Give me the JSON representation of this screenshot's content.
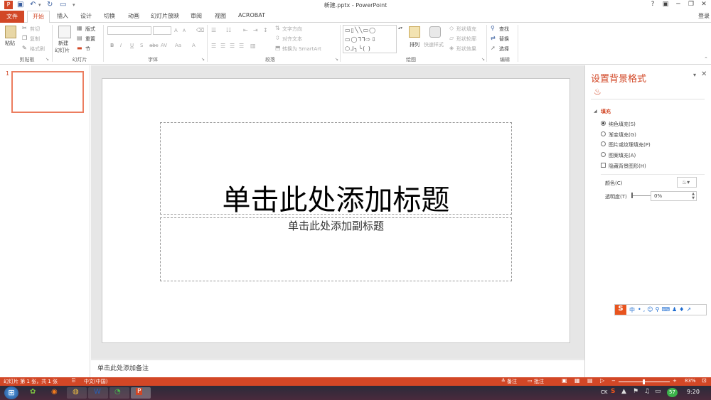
{
  "window": {
    "title": "新建.pptx - PowerPoint",
    "controls": {
      "help": "?",
      "minimize": "─",
      "restore": "❐",
      "close": "✕",
      "ribbon_options": "▣"
    },
    "login": "登录"
  },
  "tabs": [
    "文件",
    "开始",
    "插入",
    "设计",
    "切换",
    "动画",
    "幻灯片放映",
    "审阅",
    "视图",
    "ACROBAT"
  ],
  "ribbon": {
    "clipboard": {
      "paste": "粘贴",
      "cut": "剪切",
      "copy": "复制",
      "format_painter": "格式刷",
      "label": "剪贴板"
    },
    "slides": {
      "new_slide_line1": "新建",
      "new_slide_line2": "幻灯片",
      "layout": "版式",
      "reset": "重置",
      "section": "节",
      "label": "幻灯片"
    },
    "font": {
      "label": "字体",
      "bold": "B",
      "italic": "I",
      "underline": "U",
      "strike": "S",
      "shadow": "abc",
      "spacing": "AV",
      "case": "Aa",
      "grow": "A",
      "shrink": "A",
      "color": "A"
    },
    "paragraph": {
      "text_direction": "文字方向",
      "align_text": "对齐文本",
      "smartart": "转换为 SmartArt",
      "label": "段落"
    },
    "drawing": {
      "arrange": "排列",
      "quick_styles": "快速样式",
      "shape_fill": "形状填充",
      "shape_outline": "形状轮廓",
      "shape_effects": "形状效果",
      "label": "绘图"
    },
    "editing": {
      "find": "查找",
      "replace": "替换",
      "select": "选择",
      "label": "编辑"
    }
  },
  "thumbnails": [
    {
      "number": "1"
    }
  ],
  "slide": {
    "title_placeholder": "单击此处添加标题",
    "subtitle_placeholder": "单击此处添加副标题"
  },
  "notes": {
    "placeholder": "单击此处添加备注"
  },
  "format_background": {
    "title": "设置背景格式",
    "section": "填充",
    "fill_options": [
      {
        "label": "纯色填充(S)",
        "selected": true
      },
      {
        "label": "渐变填充(G)",
        "selected": false
      },
      {
        "label": "图片或纹理填充(P)",
        "selected": false
      },
      {
        "label": "图案填充(A)",
        "selected": false
      }
    ],
    "hide_background_graphics": "隐藏背景图形(H)",
    "color_label": "颜色(C)",
    "transparency_label": "透明度(T)",
    "transparency_value": "0%"
  },
  "ime": {
    "logo": "S",
    "mode": "中"
  },
  "statusbar": {
    "slide_info": "幻灯片 第 1 张，共 1 张",
    "language": "中文(中国)",
    "notes": "备注",
    "comments": "批注",
    "zoom": "83%"
  },
  "taskbar": {
    "clock": "9:20",
    "tray_lang": "CK",
    "tray_badge": "57"
  },
  "colors": {
    "accent": "#d24726",
    "statusbar": "#d24726",
    "thumbnail_border": "#ec7d5f"
  }
}
